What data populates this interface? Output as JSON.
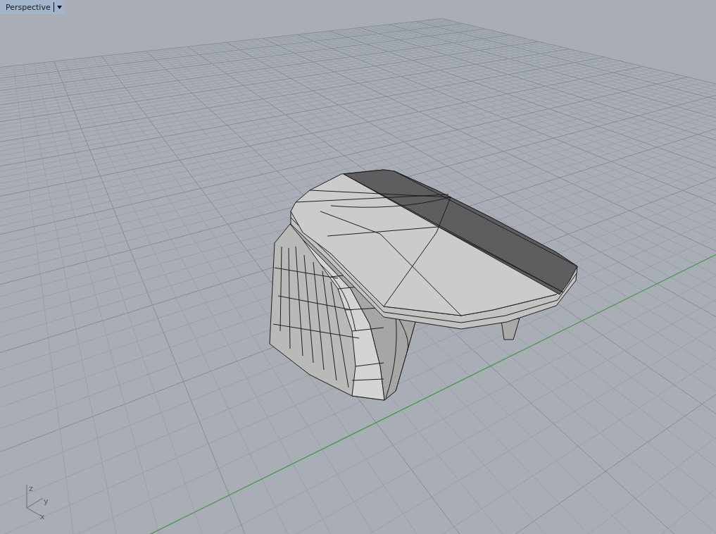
{
  "viewport": {
    "title": "Perspective"
  },
  "axis_labels": [
    {
      "label": "z"
    },
    {
      "label": "y"
    },
    {
      "label": "x"
    }
  ]
}
